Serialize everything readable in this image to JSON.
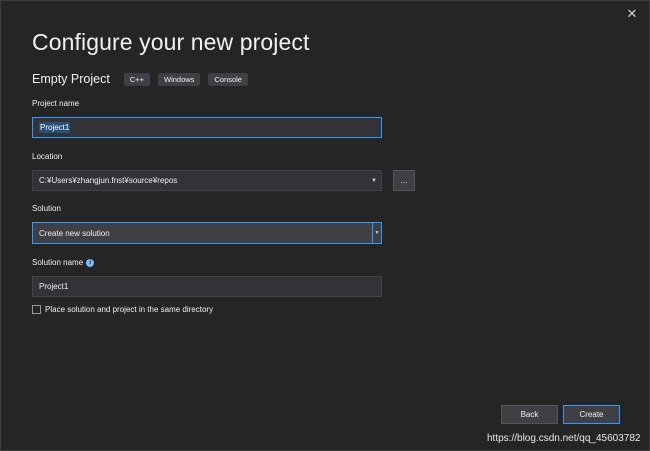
{
  "window": {
    "close_glyph": "✕"
  },
  "page_title": "Configure your new project",
  "template": {
    "name": "Empty Project",
    "tags": [
      "C++",
      "Windows",
      "Console"
    ]
  },
  "project_name": {
    "label": "Project name",
    "value": "Project1"
  },
  "location": {
    "label": "Location",
    "value": "C:¥Users¥zhangjun.fnst¥source¥repos",
    "browse_label": "..."
  },
  "solution": {
    "label": "Solution",
    "selected": "Create new solution"
  },
  "solution_name": {
    "label": "Solution name",
    "value": "Project1",
    "info_glyph": "i"
  },
  "same_directory": {
    "label": "Place solution and project in the same directory",
    "checked": false
  },
  "buttons": {
    "back": "Back",
    "create": "Create"
  },
  "watermark": "https://blog.csdn.net/qq_45603782",
  "colors": {
    "accent": "#3399ff",
    "background": "#252526",
    "input": "#333337",
    "selection": "#264f78"
  }
}
